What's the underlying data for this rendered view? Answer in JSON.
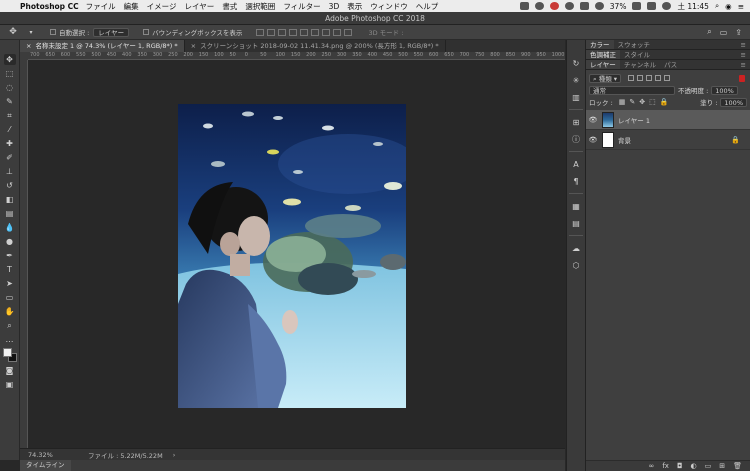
{
  "menubar": {
    "app_name": "Photoshop CC",
    "items": [
      "ファイル",
      "編集",
      "イメージ",
      "レイヤー",
      "書式",
      "選択範囲",
      "フィルター",
      "3D",
      "表示",
      "ウィンドウ",
      "ヘルプ"
    ],
    "battery": "37%",
    "clock": "土 11:45"
  },
  "window": {
    "title": "Adobe Photoshop CC 2018"
  },
  "options_bar": {
    "auto_select_label": "自動選択 :",
    "auto_select_value": "レイヤー",
    "bounding_box_label": "バウンディングボックスを表示",
    "mode_3d": "3D モード :"
  },
  "doc_tabs": [
    {
      "label": "名称未設定 1 @ 74.3% (レイヤー 1, RGB/8*) *",
      "active": true
    },
    {
      "label": "スクリーンショット 2018-09-02 11.41.34.png @ 200% (長方形 1, RGB/8*) *",
      "active": false
    }
  ],
  "ruler": {
    "ticks": [
      "700",
      "650",
      "600",
      "550",
      "500",
      "450",
      "400",
      "350",
      "300",
      "250",
      "200",
      "150",
      "100",
      "50",
      "0",
      "50",
      "100",
      "150",
      "200",
      "250",
      "300",
      "350",
      "400",
      "450",
      "500",
      "550",
      "600",
      "650",
      "700",
      "750",
      "800",
      "850",
      "900",
      "950",
      "1000"
    ]
  },
  "status": {
    "zoom": "74.32%",
    "file_info": "ファイル : 5.22M/5.22M",
    "timeline": "タイムライン"
  },
  "panels": {
    "top_tabs": [
      "カラー",
      "スウォッチ"
    ],
    "mid_tabs": [
      "色調補正",
      "スタイル"
    ],
    "layer_tabs": [
      "レイヤー",
      "チャンネル",
      "パス"
    ],
    "filter_kind": "種類",
    "blend_mode": "通常",
    "opacity_label": "不透明度 :",
    "opacity_value": "100%",
    "lock_label": "ロック :",
    "fill_label": "塗り :",
    "fill_value": "100%",
    "layers": [
      {
        "name": "レイヤー 1",
        "selected": true
      },
      {
        "name": "背景",
        "selected": false
      }
    ]
  },
  "colors": {
    "accent_red": "#c93a36",
    "panel_bg": "#3f3f3f",
    "canvas_bg": "#282828"
  }
}
